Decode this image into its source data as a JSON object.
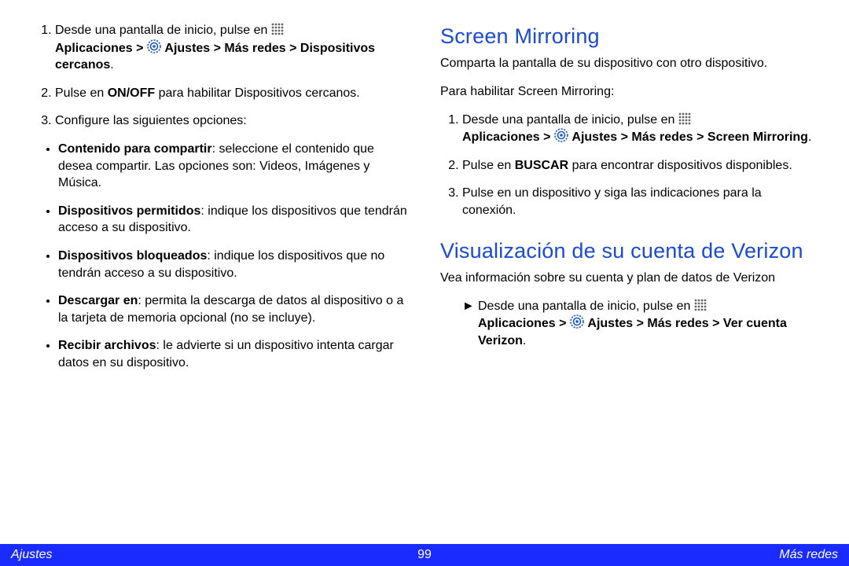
{
  "left": {
    "steps": [
      {
        "pre": "Desde una pantalla de inicio, pulse en ",
        "path": "Aplicaciones > ",
        "path2": " Ajustes > Más redes > Dispositivos cercanos",
        "post": "."
      },
      {
        "pre": "Pulse en ",
        "bold": "ON/OFF",
        "post": " para habilitar Dispositivos cercanos."
      },
      {
        "text": "Configure las siguientes opciones:"
      }
    ],
    "bullets": [
      {
        "bold": "Contenido para compartir",
        "rest": ": seleccione el contenido que desea compartir. Las opciones son: Videos, Imágenes y Música."
      },
      {
        "bold": "Dispositivos permitidos",
        "rest": ": indique los dispositivos que tendrán acceso a su dispositivo."
      },
      {
        "bold": "Dispositivos bloqueados",
        "rest": ": indique los dispositivos que no tendrán acceso a su dispositivo."
      },
      {
        "bold": "Descargar en",
        "rest": ": permita la descarga de datos al dispositivo o a la tarjeta de memoria opcional (no se incluye)."
      },
      {
        "bold": "Recibir archivos",
        "rest": ": le advierte si un dispositivo intenta cargar datos en su dispositivo."
      }
    ]
  },
  "right": {
    "h2a": "Screen Mirroring",
    "p1": "Comparta la pantalla de su dispositivo con otro dispositivo.",
    "p2": "Para habilitar Screen Mirroring:",
    "steps": [
      {
        "pre": "Desde una pantalla de inicio, pulse en ",
        "path": "Aplicaciones > ",
        "path2": " Ajustes > Más redes > Screen Mirroring",
        "post": "."
      },
      {
        "pre": "Pulse en ",
        "bold": "BUSCAR",
        "post": " para encontrar dispositivos disponibles."
      },
      {
        "text": "Pulse en un dispositivo y siga las indicaciones para la conexión."
      }
    ],
    "h2b": "Visualización de su cuenta de Verizon",
    "p3": "Vea información sobre su cuenta y plan de datos de Verizon",
    "arrowStep": {
      "marker": "►",
      "pre": "Desde una pantalla de inicio, pulse en ",
      "path": "Aplicaciones > ",
      "path2": " Ajustes > Más redes > Ver cuenta Verizon",
      "post": "."
    }
  },
  "footer": {
    "left": "Ajustes",
    "center": "99",
    "right": "Más redes"
  }
}
